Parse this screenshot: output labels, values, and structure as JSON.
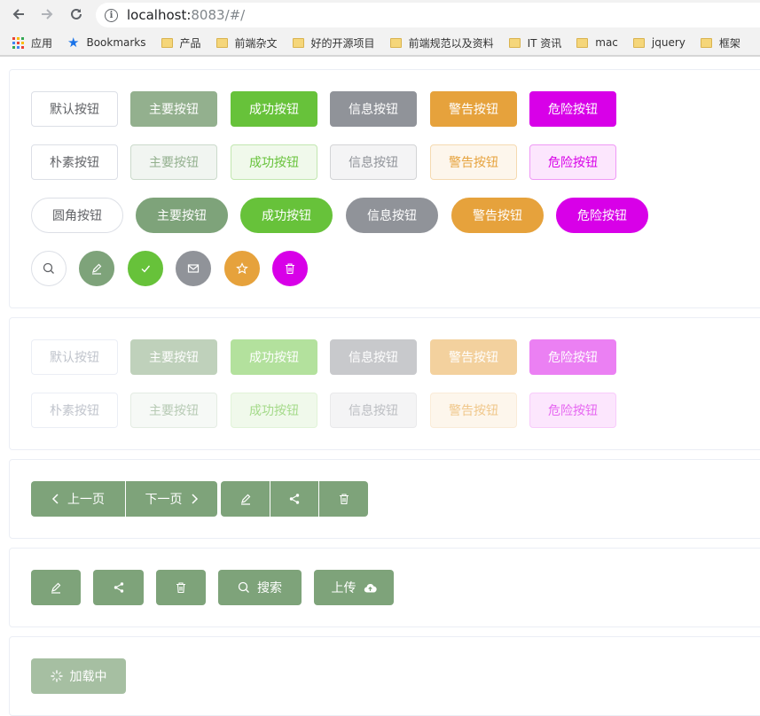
{
  "browser": {
    "url_host": "localhost:",
    "url_rest": "8083/#/"
  },
  "bookmarks": [
    {
      "label": "应用",
      "icon": "apps-icon"
    },
    {
      "label": "Bookmarks",
      "icon": "star-icon"
    },
    {
      "label": "产品",
      "icon": "folder-icon"
    },
    {
      "label": "前端杂文",
      "icon": "folder-icon"
    },
    {
      "label": "好的开源项目",
      "icon": "folder-icon"
    },
    {
      "label": "前端规范以及资料",
      "icon": "folder-icon"
    },
    {
      "label": "IT 资讯",
      "icon": "folder-icon"
    },
    {
      "label": "mac",
      "icon": "folder-icon"
    },
    {
      "label": "jquery",
      "icon": "folder-icon"
    },
    {
      "label": "框架",
      "icon": "folder-icon"
    }
  ],
  "default_row": [
    "默认按钮",
    "主要按钮",
    "成功按钮",
    "信息按钮",
    "警告按钮",
    "危险按钮"
  ],
  "plain_row": [
    "朴素按钮",
    "主要按钮",
    "成功按钮",
    "信息按钮",
    "警告按钮",
    "危险按钮"
  ],
  "round_row": [
    "圆角按钮",
    "主要按钮",
    "成功按钮",
    "信息按钮",
    "警告按钮",
    "危险按钮"
  ],
  "circle_row": [
    "search-icon",
    "edit-icon",
    "check-icon",
    "message-icon",
    "star-icon",
    "delete-icon"
  ],
  "disabled_row": [
    "默认按钮",
    "主要按钮",
    "成功按钮",
    "信息按钮",
    "警告按钮",
    "危险按钮"
  ],
  "disabled_plain_row": [
    "朴素按钮",
    "主要按钮",
    "成功按钮",
    "信息按钮",
    "警告按钮",
    "危险按钮"
  ],
  "group": {
    "prev": "上一页",
    "next": "下一页"
  },
  "icon_buttons": {
    "search": "搜索",
    "upload": "上传"
  },
  "loading": {
    "label": "加载中"
  },
  "colors": {
    "primary": "#93b08e",
    "primary_dark": "#7ea37a",
    "success": "#67c23a",
    "info": "#909399",
    "warning": "#e6a23c",
    "danger": "#d800e8"
  }
}
